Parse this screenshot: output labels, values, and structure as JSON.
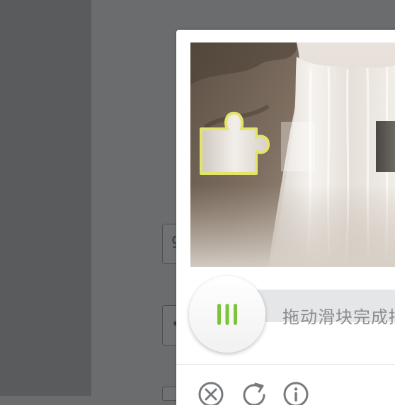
{
  "background_page": {
    "field_1_text": "9",
    "field_2_text": "•"
  },
  "captcha": {
    "slider_hint": "拖动滑块完成拼图",
    "puzzle_piece_highlight_color": "#e3e56a",
    "handle_grip_color": "#7cc43a",
    "toolbar": {
      "close_icon": "close-circle-icon",
      "refresh_icon": "refresh-icon",
      "info_icon": "info-icon"
    }
  }
}
